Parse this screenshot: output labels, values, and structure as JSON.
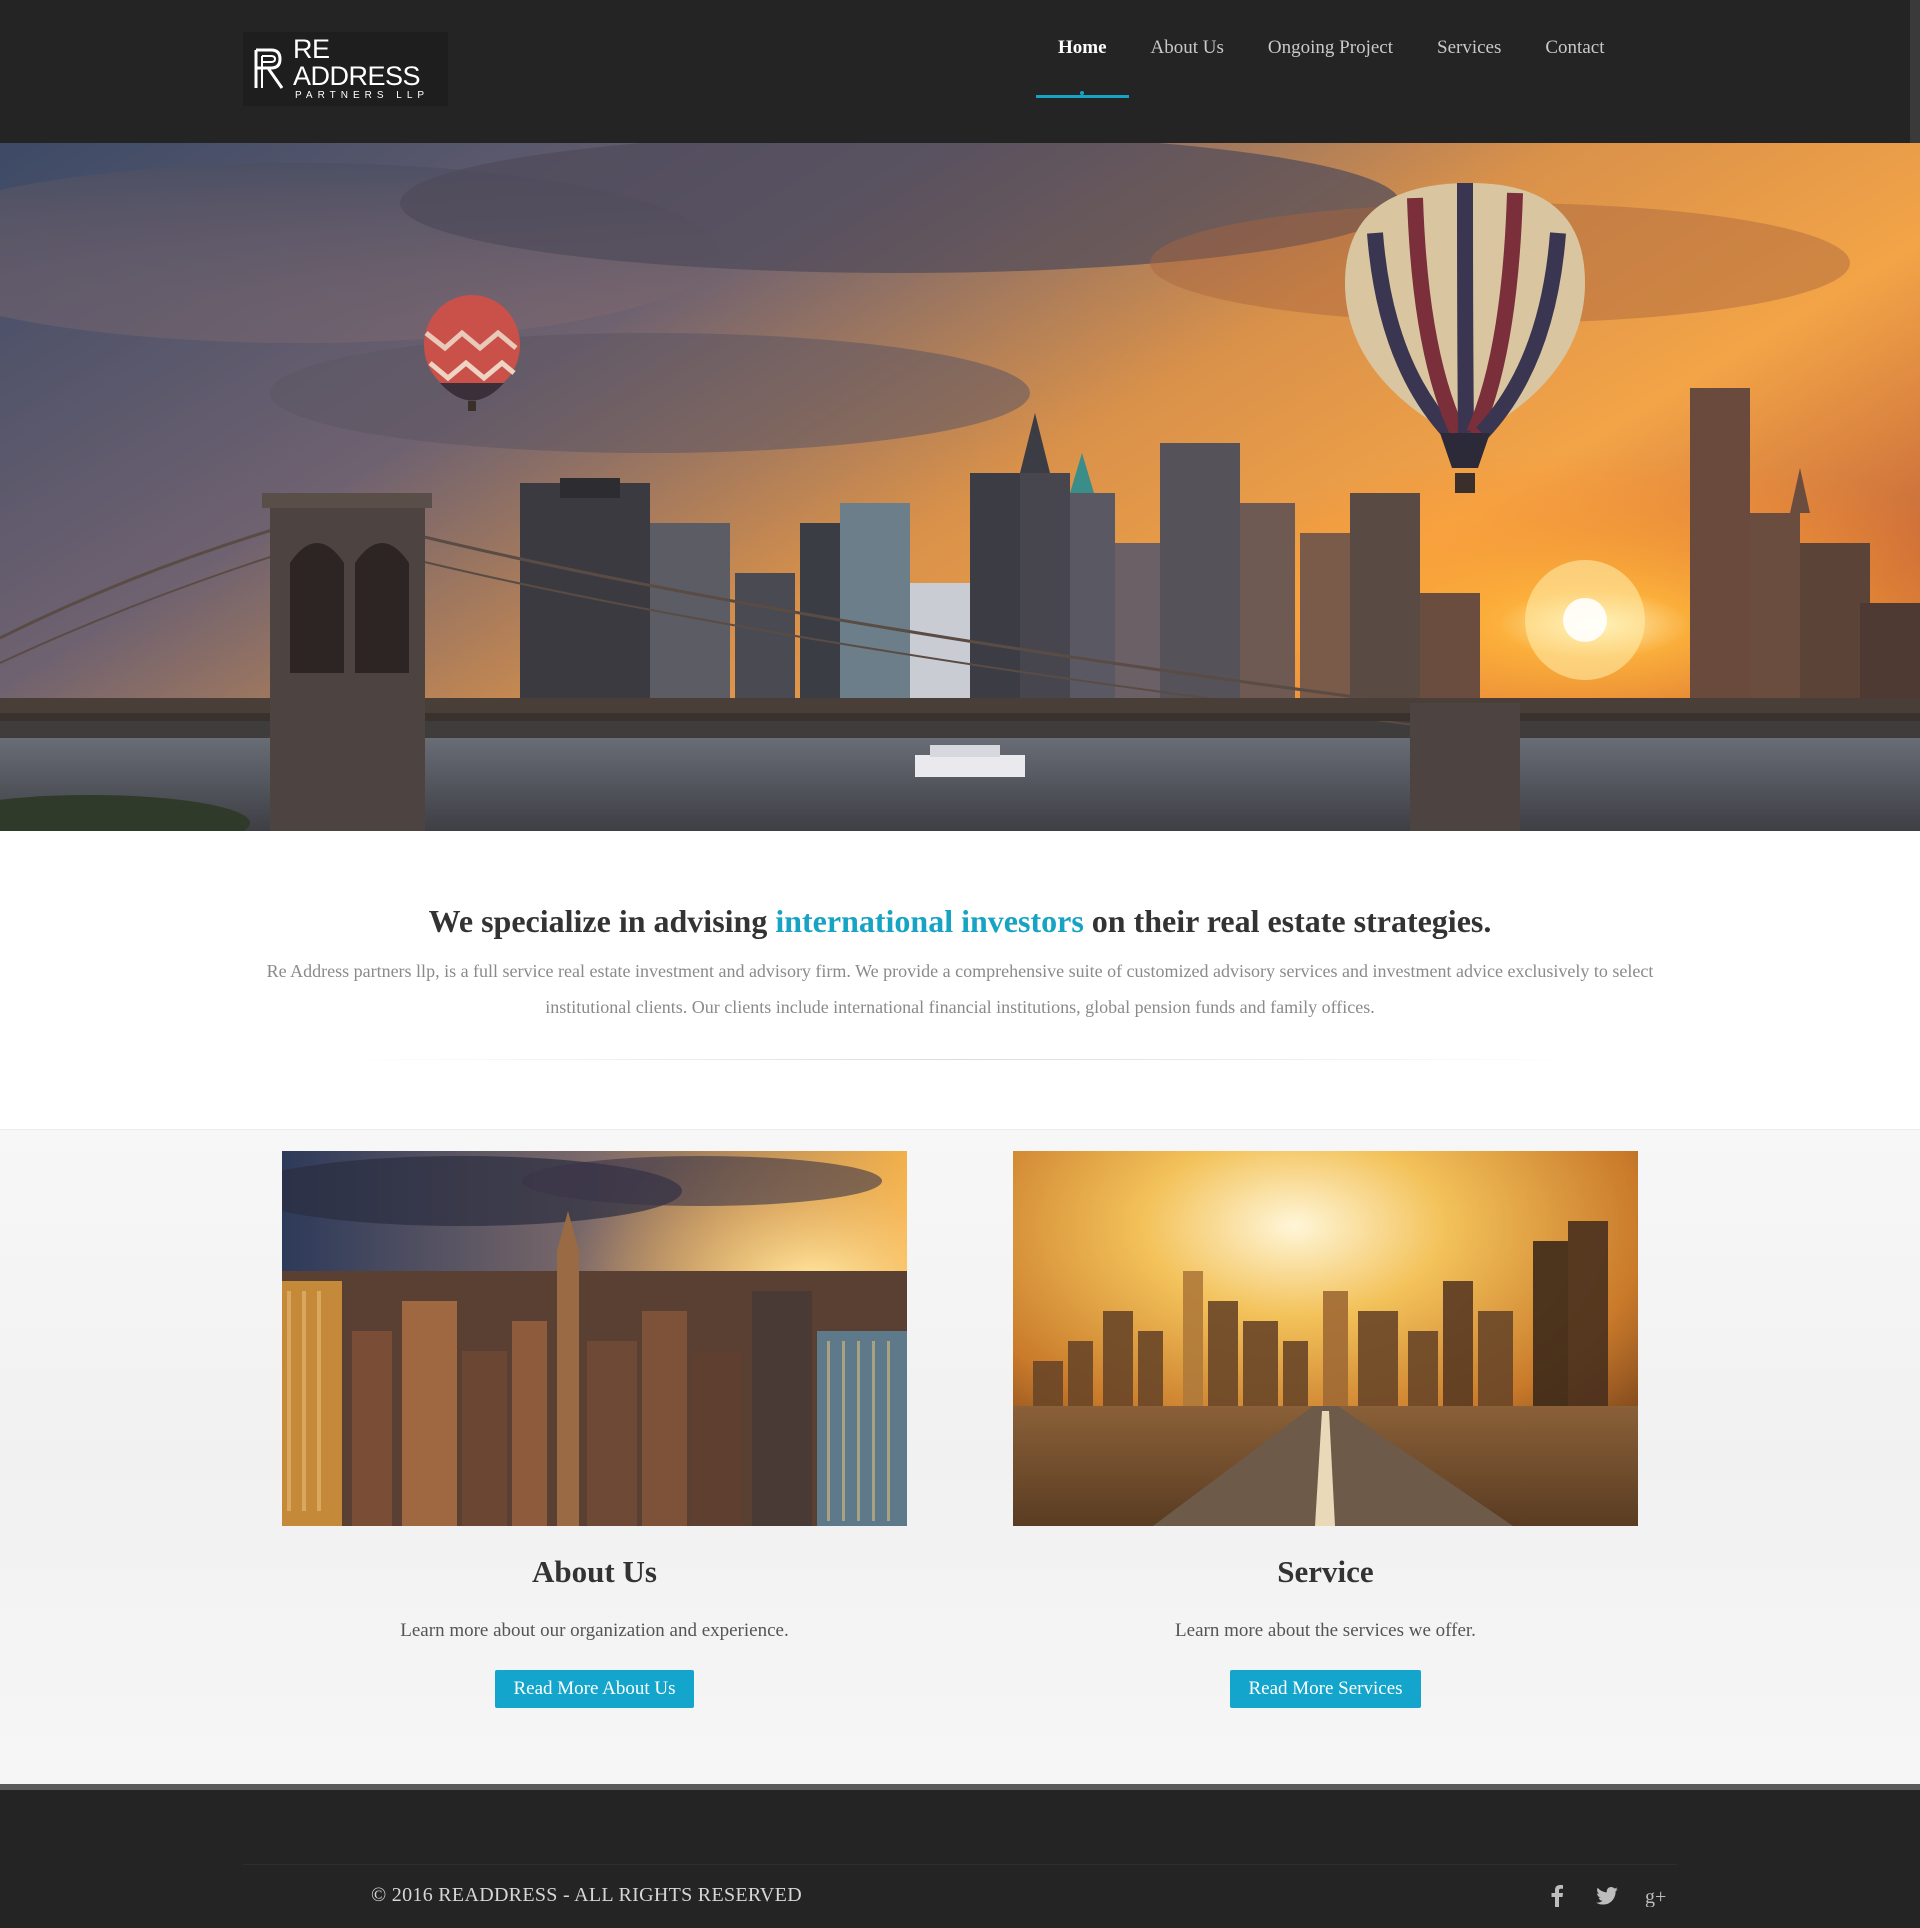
{
  "header": {
    "logo": {
      "main": "RE ADDRESS",
      "sub": "PARTNERS LLP"
    },
    "nav": [
      {
        "label": "Home",
        "active": true
      },
      {
        "label": "About Us",
        "active": false
      },
      {
        "label": "Ongoing Project",
        "active": false
      },
      {
        "label": "Services",
        "active": false
      },
      {
        "label": "Contact",
        "active": false
      }
    ]
  },
  "intro": {
    "heading_before": "We specialize in advising ",
    "heading_highlight": "international investors",
    "heading_after": " on their real estate strategies.",
    "text": "Re Address partners llp, is a full service real estate investment and advisory firm. We provide a comprehensive suite of customized advisory services and investment advice exclusively to select institutional clients. Our clients include international financial institutions, global pension funds and family offices."
  },
  "features": [
    {
      "title": "About Us",
      "description": "Learn more about our organization and experience.",
      "button": "Read More About Us"
    },
    {
      "title": "Service",
      "description": "Learn more about the services we offer.",
      "button": "Read More Services"
    }
  ],
  "footer": {
    "copyright": "© 2016 READDRESS - ALL RIGHTS RESERVED",
    "social": [
      "facebook-icon",
      "twitter-icon",
      "google-plus-icon"
    ]
  },
  "colors": {
    "accent": "#17a3c4",
    "header_bg": "#242424",
    "button_bg": "#13a5cc"
  }
}
